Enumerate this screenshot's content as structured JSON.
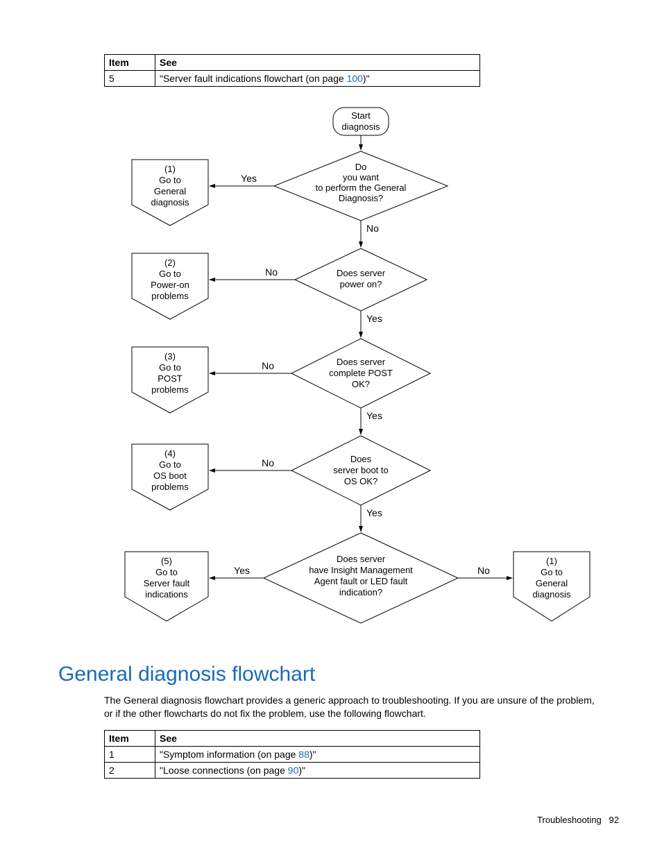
{
  "top_table": {
    "headers": {
      "item": "Item",
      "see": "See"
    },
    "row": {
      "item": "5",
      "see_prefix": "\"Server fault indications flowchart (on page ",
      "see_link": "100",
      "see_suffix": ")\""
    }
  },
  "flowchart": {
    "start": "Start\ndiagnosis",
    "d1": "Do\nyou want\nto perform the General\nDiagnosis?",
    "d2": "Does server\npower on?",
    "d3": "Does server\ncomplete POST\nOK?",
    "d4": "Does\nserver boot to\nOS OK?",
    "d5": "Does server\nhave Insight Management\nAgent fault or LED fault\nindication?",
    "off1": "(1)\nGo to\nGeneral\ndiagnosis",
    "off2": "(2)\nGo to\nPower-on\nproblems",
    "off3": "(3)\nGo to\nPOST\nproblems",
    "off4": "(4)\nGo to\nOS boot\nproblems",
    "off5": "(5)\nGo to\nServer fault\nindications",
    "off1r": "(1)\nGo to\nGeneral\ndiagnosis",
    "yes": "Yes",
    "no": "No"
  },
  "heading": "General diagnosis flowchart",
  "paragraph": "The General diagnosis flowchart provides a generic approach to troubleshooting. If you are unsure of the problem, or if the other flowcharts do not fix the problem, use the following flowchart.",
  "bottom_table": {
    "headers": {
      "item": "Item",
      "see": "See"
    },
    "rows": [
      {
        "item": "1",
        "see_prefix": "\"Symptom information (on page ",
        "see_link": "88",
        "see_suffix": ")\""
      },
      {
        "item": "2",
        "see_prefix": "\"Loose connections (on page ",
        "see_link": "90",
        "see_suffix": ")\""
      }
    ]
  },
  "footer": {
    "section": "Troubleshooting",
    "page": "92"
  }
}
